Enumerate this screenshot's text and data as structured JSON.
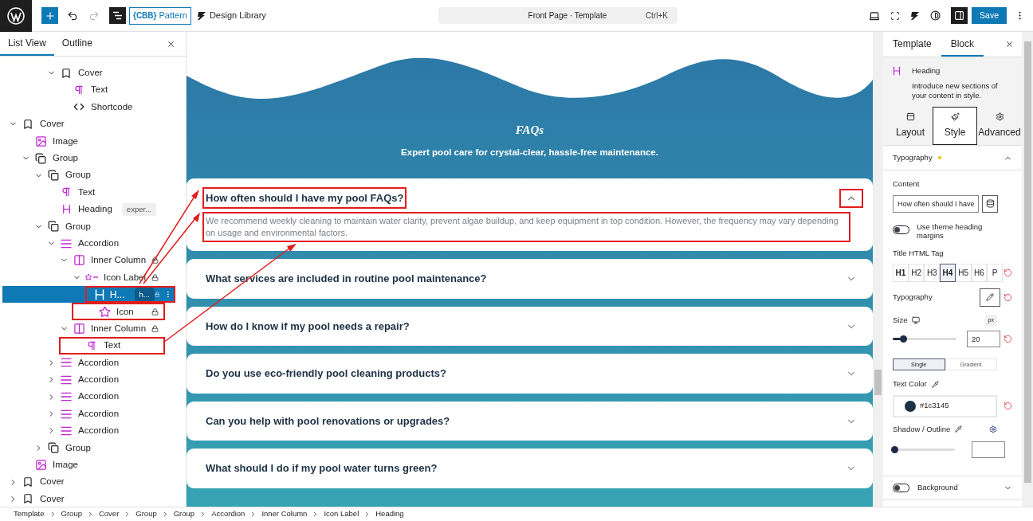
{
  "toolbar": {
    "pattern_button": "Pattern",
    "pattern_logo": "{CBB}",
    "design_library": "Design Library",
    "command": {
      "title": "Front Page · Template",
      "shortcut": "Ctrl+K"
    },
    "save": "Save",
    "undo_disabled": false,
    "redo_disabled": true,
    "list_view_active": true,
    "sidebar_active": true
  },
  "left_panel": {
    "tabs": [
      {
        "label": "List View",
        "selected": true
      },
      {
        "label": "Outline",
        "selected": false
      }
    ],
    "tree_partial": [
      {
        "label": "Cover",
        "kind": "cover",
        "expanded": true,
        "selected": false,
        "locked": false,
        "children": [
          {
            "label": "Text",
            "kind": "text",
            "selected": false,
            "locked": false
          },
          {
            "label": "Shortcode",
            "kind": "shortcode",
            "selected": false,
            "locked": false
          }
        ]
      }
    ],
    "tree": [
      {
        "label": "Cover",
        "kind": "cover",
        "expanded": true,
        "selected": false,
        "locked": false,
        "children": [
          {
            "label": "Image",
            "kind": "image",
            "selected": false,
            "locked": false
          },
          {
            "label": "Group",
            "kind": "group",
            "expanded": true,
            "selected": false,
            "locked": false,
            "children": [
              {
                "label": "Group",
                "kind": "group",
                "expanded": true,
                "selected": false,
                "locked": false,
                "children": [
                  {
                    "label": "Text",
                    "kind": "text",
                    "selected": false,
                    "locked": false
                  },
                  {
                    "label": "Heading",
                    "kind": "heading",
                    "selected": false,
                    "locked": false,
                    "badge": "exper..."
                  }
                ]
              },
              {
                "label": "Group",
                "kind": "group",
                "expanded": true,
                "selected": false,
                "locked": false,
                "children": [
                  {
                    "label": "Accordion",
                    "kind": "accordion",
                    "expanded": true,
                    "selected": false,
                    "locked": false,
                    "children": [
                      {
                        "label": "Inner Column",
                        "kind": "column",
                        "expanded": true,
                        "selected": false,
                        "locked": true,
                        "children": [
                          {
                            "label": "Icon Label",
                            "kind": "iconlabel",
                            "expanded": true,
                            "selected": false,
                            "locked": true,
                            "children": [
                              {
                                "label": "H...",
                                "kind": "heading",
                                "selected": true,
                                "locked": true,
                                "badge": "h...",
                                "annotated": true
                              },
                              {
                                "label": "Icon",
                                "kind": "icon",
                                "selected": false,
                                "locked": true,
                                "annotated": true
                              }
                            ]
                          }
                        ]
                      },
                      {
                        "label": "Inner Column",
                        "kind": "column",
                        "expanded": true,
                        "selected": false,
                        "locked": true,
                        "children": [
                          {
                            "label": "Text",
                            "kind": "text",
                            "selected": false,
                            "locked": false,
                            "annotated": true
                          }
                        ]
                      }
                    ]
                  },
                  {
                    "label": "Accordion",
                    "kind": "accordion",
                    "expanded": false,
                    "selected": false,
                    "locked": false
                  },
                  {
                    "label": "Accordion",
                    "kind": "accordion",
                    "expanded": false,
                    "selected": false,
                    "locked": false
                  },
                  {
                    "label": "Accordion",
                    "kind": "accordion",
                    "expanded": false,
                    "selected": false,
                    "locked": false
                  },
                  {
                    "label": "Accordion",
                    "kind": "accordion",
                    "expanded": false,
                    "selected": false,
                    "locked": false
                  },
                  {
                    "label": "Accordion",
                    "kind": "accordion",
                    "expanded": false,
                    "selected": false,
                    "locked": false
                  }
                ]
              },
              {
                "label": "Group",
                "kind": "group",
                "expanded": false,
                "selected": false,
                "locked": false
              }
            ]
          },
          {
            "label": "Image",
            "kind": "image",
            "selected": false,
            "locked": false
          }
        ]
      },
      {
        "label": "Cover",
        "kind": "cover",
        "expanded": false,
        "selected": false,
        "locked": false
      },
      {
        "label": "Cover",
        "kind": "cover",
        "expanded": false,
        "selected": false,
        "locked": false
      }
    ]
  },
  "canvas": {
    "title": "FAQs",
    "subtitle": "Expert pool care for crystal-clear, hassle-free maintenance.",
    "faqs": [
      {
        "question": "How often should I have my pool FAQs?",
        "answer": "We recommend weekly cleaning to maintain water clarity, prevent algae buildup, and keep equipment in top condition. However, the frequency may vary depending on usage and environmental factors.",
        "expanded": true,
        "annotated": true
      },
      {
        "question": "What services are included in routine pool maintenance?",
        "expanded": false,
        "annotated": false
      },
      {
        "question": "How do I know if my pool needs a repair?",
        "expanded": false,
        "annotated": false
      },
      {
        "question": "Do you use eco-friendly pool cleaning products?",
        "expanded": false,
        "annotated": false
      },
      {
        "question": "Can you help with pool renovations or upgrades?",
        "expanded": false,
        "annotated": false
      },
      {
        "question": "What should I do if my pool water turns green?",
        "expanded": false,
        "annotated": false
      }
    ]
  },
  "right_panel": {
    "tabs": [
      {
        "label": "Template",
        "selected": false
      },
      {
        "label": "Block",
        "selected": true
      }
    ],
    "block": {
      "title": "Heading",
      "description": "Introduce new sections of your content in style."
    },
    "sub_tabs": [
      {
        "label": "Layout",
        "kind": "layout",
        "selected": false
      },
      {
        "label": "Style",
        "kind": "brush",
        "selected": true
      },
      {
        "label": "Advanced",
        "kind": "gear",
        "selected": false
      }
    ],
    "typography": {
      "title": "Typography",
      "modified": true,
      "expanded": true,
      "content_label": "Content",
      "content_value": "How often should I have",
      "margins_label": "Use theme heading margins",
      "margins_on": false,
      "tag_label": "Title HTML Tag",
      "tags": [
        {
          "label": "H1",
          "selected": false
        },
        {
          "label": "H2",
          "selected": false
        },
        {
          "label": "H3",
          "selected": false
        },
        {
          "label": "H4",
          "selected": true
        },
        {
          "label": "H5",
          "selected": false
        },
        {
          "label": "H6",
          "selected": false
        },
        {
          "label": "P",
          "selected": false
        }
      ],
      "typography_label": "Typography",
      "size_label": "Size",
      "size_unit": "px",
      "size": {
        "level": 0.12,
        "value": "20"
      },
      "color_modes": [
        {
          "label": "Single",
          "selected": true
        },
        {
          "label": "Gradient",
          "selected": false
        }
      ],
      "text_color_label": "Text Color",
      "text_color": "#1c3145",
      "shadow_label": "Shadow / Outline",
      "shadow": {
        "level": 0
      }
    },
    "background": {
      "label": "Background",
      "on": false
    }
  },
  "breadcrumb": [
    "Template",
    "Group",
    "Cover",
    "Group",
    "Group",
    "Accordion",
    "Inner Column",
    "Icon Label",
    "Heading"
  ]
}
